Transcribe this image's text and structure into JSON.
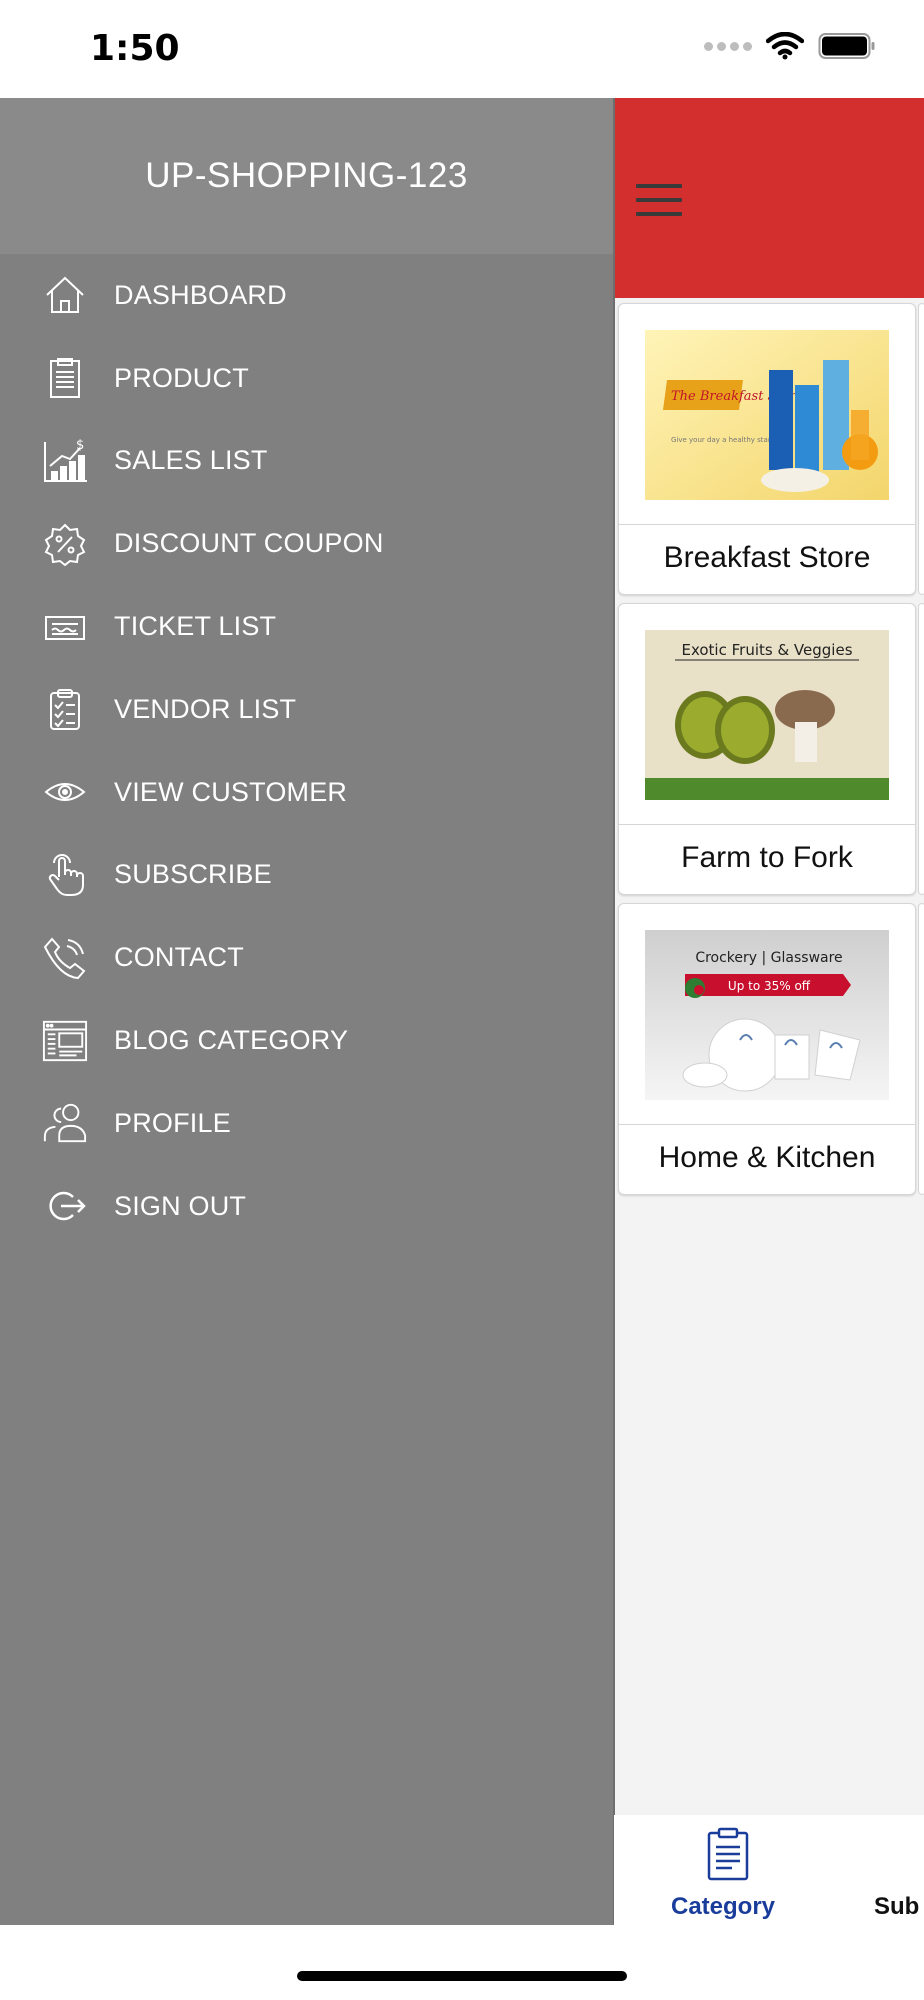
{
  "status_bar": {
    "time": "1:50"
  },
  "drawer": {
    "title": "UP-SHOPPING-123",
    "items": [
      {
        "label": "DASHBOARD",
        "icon": "home-icon"
      },
      {
        "label": "PRODUCT",
        "icon": "clipboard-list-icon"
      },
      {
        "label": "SALES LIST",
        "icon": "sales-chart-icon"
      },
      {
        "label": "DISCOUNT COUPON",
        "icon": "discount-badge-icon"
      },
      {
        "label": "TICKET LIST",
        "icon": "ticket-icon"
      },
      {
        "label": "VENDOR LIST",
        "icon": "checklist-icon"
      },
      {
        "label": "VIEW CUSTOMER",
        "icon": "eye-icon"
      },
      {
        "label": "SUBSCRIBE",
        "icon": "tap-hand-icon"
      },
      {
        "label": "CONTACT",
        "icon": "phone-icon"
      },
      {
        "label": "BLOG CATEGORY",
        "icon": "browser-window-icon"
      },
      {
        "label": "PROFILE",
        "icon": "users-icon"
      },
      {
        "label": "SIGN OUT",
        "icon": "sign-out-icon"
      }
    ]
  },
  "colors": {
    "app_bar": "#d32f2f",
    "drawer_bg": "#808080",
    "nav_active": "#1a3d9c"
  },
  "categories": [
    {
      "name": "Breakfast Store",
      "image_text": [
        "The Breakfast Store",
        "Give your day a healthy start!"
      ]
    },
    {
      "name": "Farm to Fork",
      "image_text": [
        "Exotic Fruits & Veggies"
      ]
    },
    {
      "name": "Home & Kitchen",
      "image_text": [
        "Crockery | Glassware",
        "Up to 35% off"
      ]
    }
  ],
  "bottom_nav": {
    "tabs": [
      {
        "label": "Category",
        "active": true
      },
      {
        "label": "Sub",
        "active": false
      }
    ]
  }
}
